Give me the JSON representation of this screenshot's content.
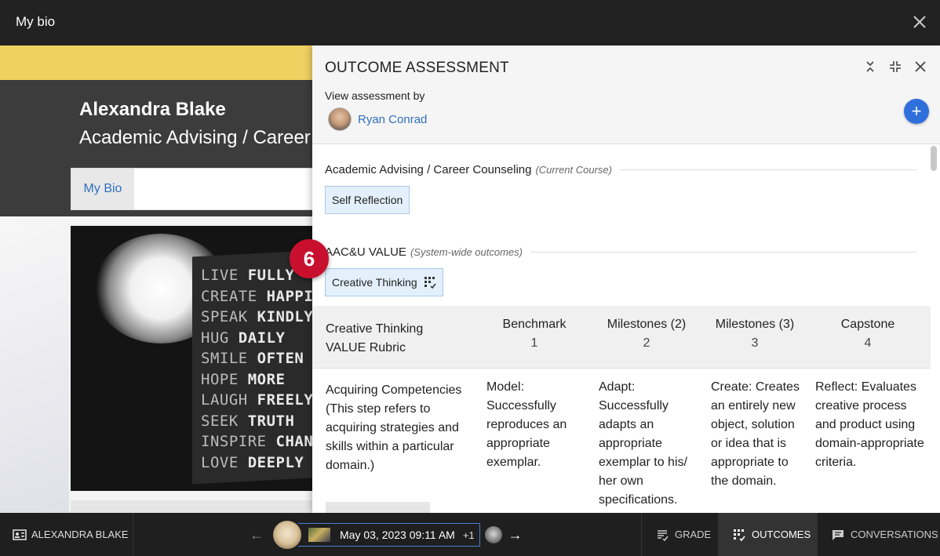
{
  "window": {
    "title": "My bio"
  },
  "background_page": {
    "person_name": "Alexandra Blake",
    "course_name": "Academic Advising / Career Counseling",
    "tab_label": "My Bio",
    "photo_quote_lines": [
      [
        "LIVE",
        "FULLY"
      ],
      [
        "CREATE",
        "HAPPIN"
      ],
      [
        "SPEAK",
        "KINDLY"
      ],
      [
        "HUG",
        "DAILY"
      ],
      [
        "SMILE",
        "OFTEN"
      ],
      [
        "HOPE",
        "MORE"
      ],
      [
        "LAUGH",
        "FREELY"
      ],
      [
        "SEEK",
        "TRUTH"
      ],
      [
        "INSPIRE",
        "CHANG"
      ],
      [
        "LOVE",
        "DEEPLY"
      ]
    ]
  },
  "step_badge": "6",
  "panel": {
    "title": "OUTCOME ASSESSMENT",
    "view_by_label": "View assessment by",
    "assessor_name": "Ryan Conrad",
    "add_button": "+",
    "sections": [
      {
        "title": "Academic Advising / Career Counseling",
        "subtitle": "(Current Course)",
        "chip": "Self Reflection"
      },
      {
        "title": "AAC&U VALUE",
        "subtitle": "(System-wide outcomes)",
        "chip": "Creative Thinking"
      }
    ],
    "rubric": {
      "name": "Creative Thinking VALUE Rubric",
      "levels": [
        {
          "label": "Benchmark",
          "num": "1"
        },
        {
          "label": "Milestones (2)",
          "num": "2"
        },
        {
          "label": "Milestones (3)",
          "num": "3"
        },
        {
          "label": "Capstone",
          "num": "4"
        }
      ],
      "criterion": "Acquiring Competencies (This step refers to acquiring strategies and skills within a particular domain.)",
      "cells": [
        "Model: Successfully reproduces an appropriate exemplar.",
        "Adapt: Successfully adapts an appropriate exemplar to his/ her own specifications.",
        "Create: Creates an entirely new object, solution or idea that is appropriate to the domain.",
        "Reflect: Evaluates creative process and product using domain-appropriate criteria."
      ]
    }
  },
  "bottom_bar": {
    "student": "ALEXANDRA BLAKE",
    "attempt_date": "May 03, 2023 09:11 AM",
    "attempt_more": "+1",
    "tabs": {
      "grade": "GRADE",
      "outcomes": "OUTCOMES",
      "conversations": "CONVERSATIONS"
    }
  },
  "colors": {
    "accent": "#2f6fdc",
    "link": "#2f6fbf",
    "badge": "#c8102e",
    "banner": "#f0d060"
  }
}
